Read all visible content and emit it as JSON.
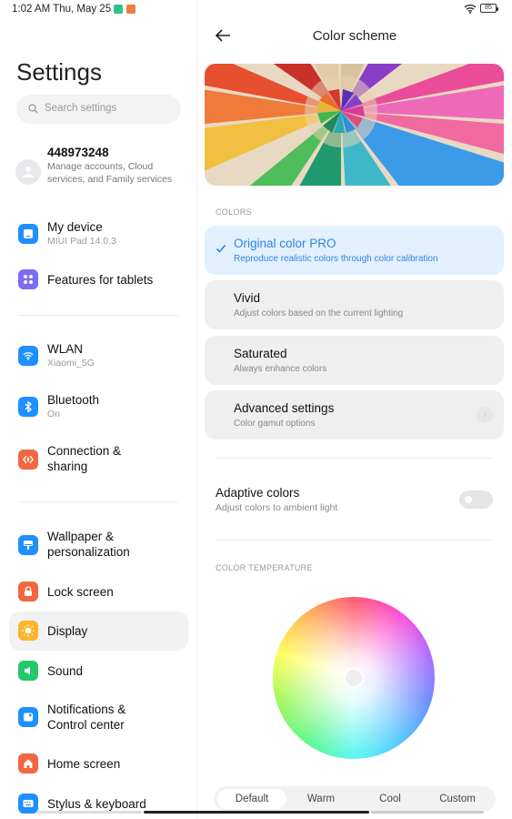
{
  "status_bar": {
    "time": "1:02 AM Thu, May 25",
    "notification_icons": [
      "green-app-icon",
      "orange-app-icon"
    ],
    "battery": "85",
    "wifi": "wifi-icon"
  },
  "sidebar": {
    "title": "Settings",
    "search": {
      "placeholder": "Search settings"
    },
    "account": {
      "title": "448973248",
      "subtitle": "Manage accounts, Cloud services, and Family services"
    },
    "items": [
      {
        "label": "My device",
        "sub": "MIUI Pad 14.0.3",
        "icon": "tablet-icon",
        "color": "#1e90ff"
      },
      {
        "label": "Features for tablets",
        "icon": "grid-icon",
        "color": "#7b6cf6"
      },
      {
        "label": "WLAN",
        "sub": "Xiaomi_5G",
        "icon": "wifi-icon",
        "color": "#1e90ff"
      },
      {
        "label": "Bluetooth",
        "sub": "On",
        "icon": "bluetooth-icon",
        "color": "#1e90ff"
      },
      {
        "label": "Connection & sharing",
        "icon": "connection-icon",
        "color": "#f2673f"
      },
      {
        "label": "Wallpaper & personalization",
        "icon": "wallpaper-icon",
        "color": "#1e90ff"
      },
      {
        "label": "Lock screen",
        "icon": "lock-icon",
        "color": "#f2673f"
      },
      {
        "label": "Display",
        "icon": "sun-icon",
        "color": "#fbb52e",
        "selected": true
      },
      {
        "label": "Sound",
        "icon": "speaker-icon",
        "color": "#22c86a"
      },
      {
        "label": "Notifications & Control center",
        "icon": "notification-icon",
        "color": "#1e90ff"
      },
      {
        "label": "Home screen",
        "icon": "home-icon",
        "color": "#f2673f"
      },
      {
        "label": "Stylus & keyboard",
        "icon": "keyboard-icon",
        "color": "#1e90ff"
      }
    ]
  },
  "main": {
    "title": "Color scheme",
    "colors_section": "COLORS",
    "options": [
      {
        "title": "Original color PRO",
        "subtitle": "Reproduce realistic colors through color calibration",
        "selected": true
      },
      {
        "title": "Vivid",
        "subtitle": "Adjust colors based on the current lighting"
      },
      {
        "title": "Saturated",
        "subtitle": "Always enhance colors"
      },
      {
        "title": "Advanced settings",
        "subtitle": "Color gamut options"
      }
    ],
    "adaptive": {
      "title": "Adaptive colors",
      "subtitle": "Adjust colors to ambient light",
      "enabled": false
    },
    "temperature_section": "COLOR TEMPERATURE",
    "temperature_tabs": [
      "Default",
      "Warm",
      "Cool",
      "Custom"
    ],
    "temperature_selected": "Default",
    "accent": "#2d86e6"
  }
}
